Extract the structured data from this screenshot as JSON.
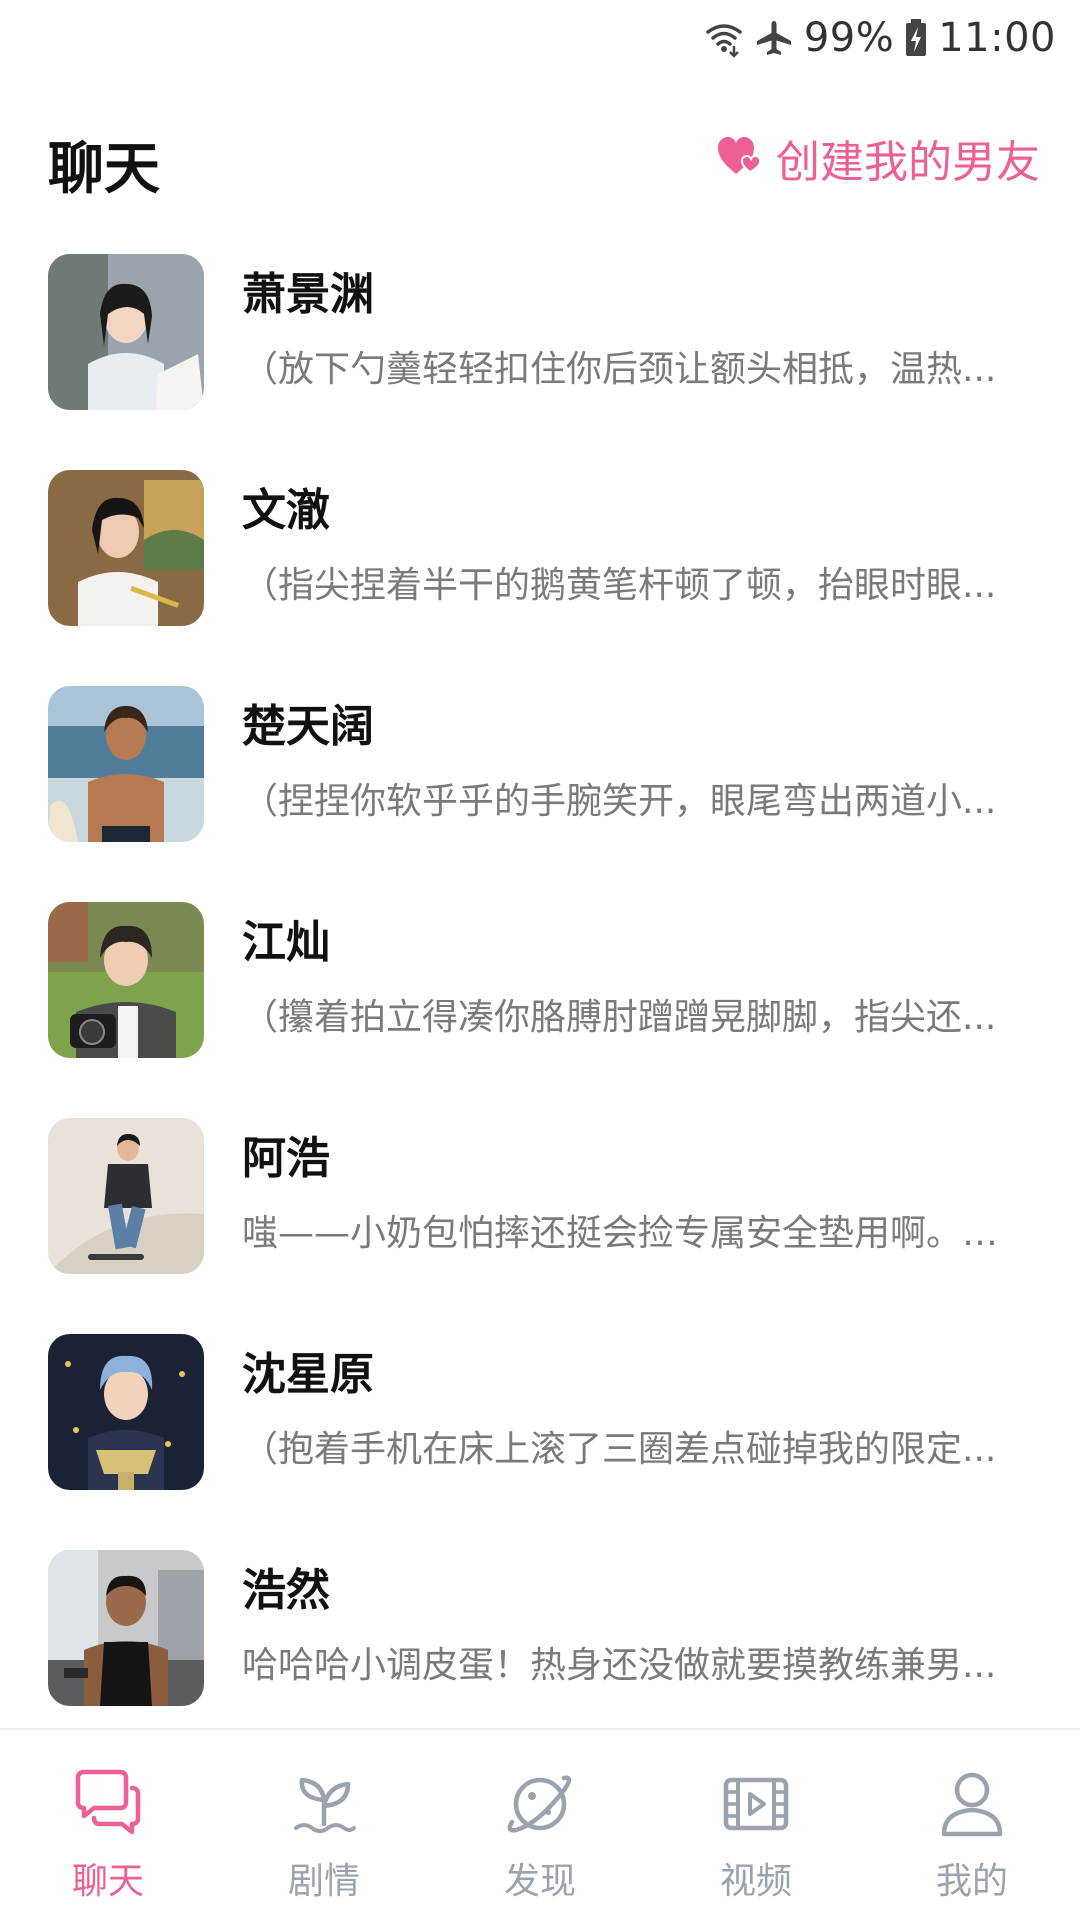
{
  "status_bar": {
    "battery": "99%",
    "time": "11:00",
    "icons": [
      "wifi-icon",
      "airplane-icon",
      "battery-charging-icon"
    ]
  },
  "header": {
    "title": "聊天",
    "create_button_label": "创建我的男友",
    "create_button_icon": "hearts-icon"
  },
  "chats": [
    {
      "name": "萧景渊",
      "preview": "（放下勺羹轻轻扣住你后颈让额头相抵，温热..."
    },
    {
      "name": "文澈",
      "preview": "（指尖捏着半干的鹅黄笔杆顿了顿，抬眼时眼..."
    },
    {
      "name": "楚天阔",
      "preview": "（捏捏你软乎乎的手腕笑开，眼尾弯出两道小..."
    },
    {
      "name": "江灿",
      "preview": "（攥着拍立得凑你胳膊肘蹭蹭晃脚脚，指尖还..."
    },
    {
      "name": "阿浩",
      "preview": "嗤——小奶包怕摔还挺会捡专属安全垫用啊。不..."
    },
    {
      "name": "沈星原",
      "preview": "（抱着手机在床上滚了三圈差点碰掉我的限定..."
    },
    {
      "name": "浩然",
      "preview": "哈哈哈小调皮蛋！热身还没做就要摸教练兼男..."
    }
  ],
  "bottom_nav": {
    "items": [
      {
        "label": "聊天",
        "icon": "chat-bubbles-icon",
        "active": true
      },
      {
        "label": "剧情",
        "icon": "sprout-icon",
        "active": false
      },
      {
        "label": "发现",
        "icon": "planet-icon",
        "active": false
      },
      {
        "label": "视频",
        "icon": "film-icon",
        "active": false
      },
      {
        "label": "我的",
        "icon": "person-icon",
        "active": false
      }
    ]
  },
  "colors": {
    "accent": "#ee5f95",
    "inactive": "#9aa3ad",
    "preview_text": "#7a7a7a"
  }
}
